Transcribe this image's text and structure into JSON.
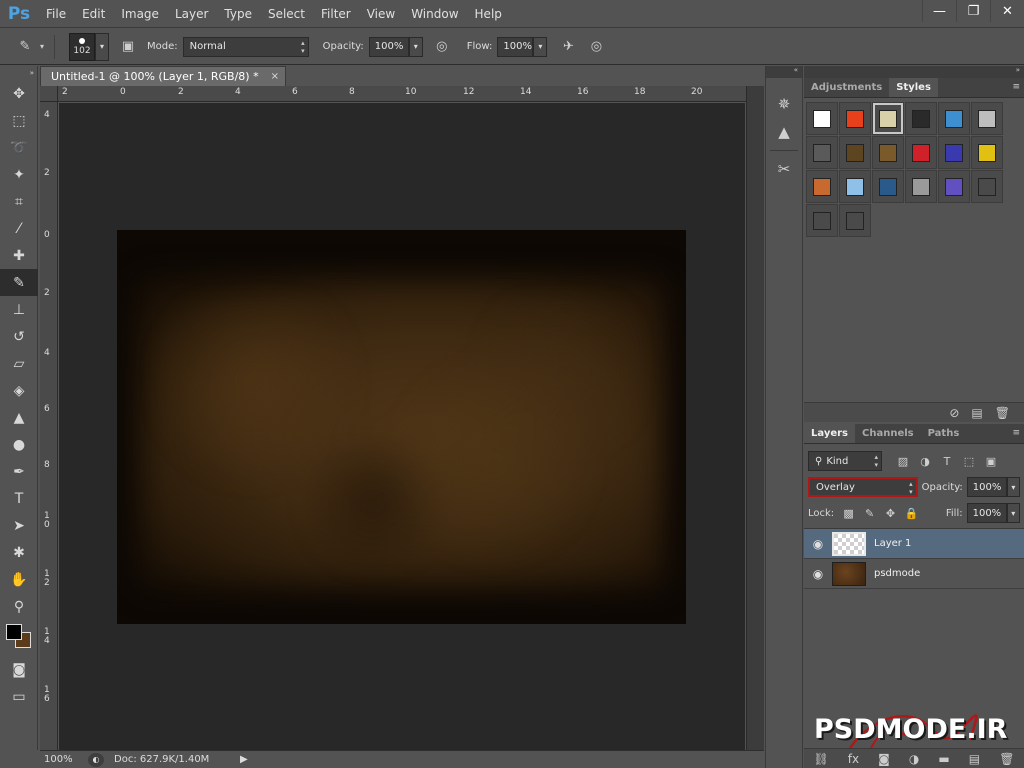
{
  "app": {
    "logo": "Ps"
  },
  "menu": [
    "File",
    "Edit",
    "Image",
    "Layer",
    "Type",
    "Select",
    "Filter",
    "View",
    "Window",
    "Help"
  ],
  "window_controls": {
    "minimize": "—",
    "restore": "❐",
    "close": "✕"
  },
  "options": {
    "brush_size": "102",
    "mode_label": "Mode:",
    "mode_value": "Normal",
    "opacity_label": "Opacity:",
    "opacity_value": "100%",
    "flow_label": "Flow:",
    "flow_value": "100%"
  },
  "document": {
    "tab_title": "Untitled-1 @ 100% (Layer 1, RGB/8) *",
    "close": "×"
  },
  "ruler_top": [
    "2",
    "0",
    "2",
    "4",
    "6",
    "8",
    "10",
    "12",
    "14",
    "16",
    "18",
    "20"
  ],
  "ruler_left": [
    "4",
    "2",
    "0",
    "2",
    "4",
    "6",
    "8",
    "1\n0",
    "1\n2",
    "1\n4",
    "1\n6"
  ],
  "status": {
    "zoom": "100%",
    "doc": "Doc: 627.9K/1.40M"
  },
  "panels": {
    "adjustments_tab": "Adjustments",
    "styles_tab": "Styles",
    "layers_tab": "Layers",
    "channels_tab": "Channels",
    "paths_tab": "Paths"
  },
  "styles_swatches": [
    "#ffffff",
    "#e8401b",
    "#d8d0a8",
    "#2a2a2a",
    "#3e8fcf",
    "#bdbdbd",
    "#5a5a5a",
    "#5c4520",
    "#7a5a2a",
    "#d0202a",
    "#3a3ab0",
    "#e0c010",
    "#c86a30",
    "#8ec0e8",
    "#2a5a8a",
    "#9a9a9a",
    "#6050c0",
    "#4a4a4a",
    "#4a4a4a",
    "#4a4a4a"
  ],
  "layers": {
    "kind": "Kind",
    "blend_mode": "Overlay",
    "opacity_label": "Opacity:",
    "opacity_value": "100%",
    "lock_label": "Lock:",
    "fill_label": "Fill:",
    "fill_value": "100%",
    "items": [
      {
        "name": "Layer 1"
      },
      {
        "name": "psdmode"
      }
    ]
  },
  "watermark": {
    "text": "PSDMODE.IR"
  },
  "colors": {
    "highlight": "#b01717",
    "selected_layer": "#566a7f",
    "canvas_bg": "#282828"
  }
}
